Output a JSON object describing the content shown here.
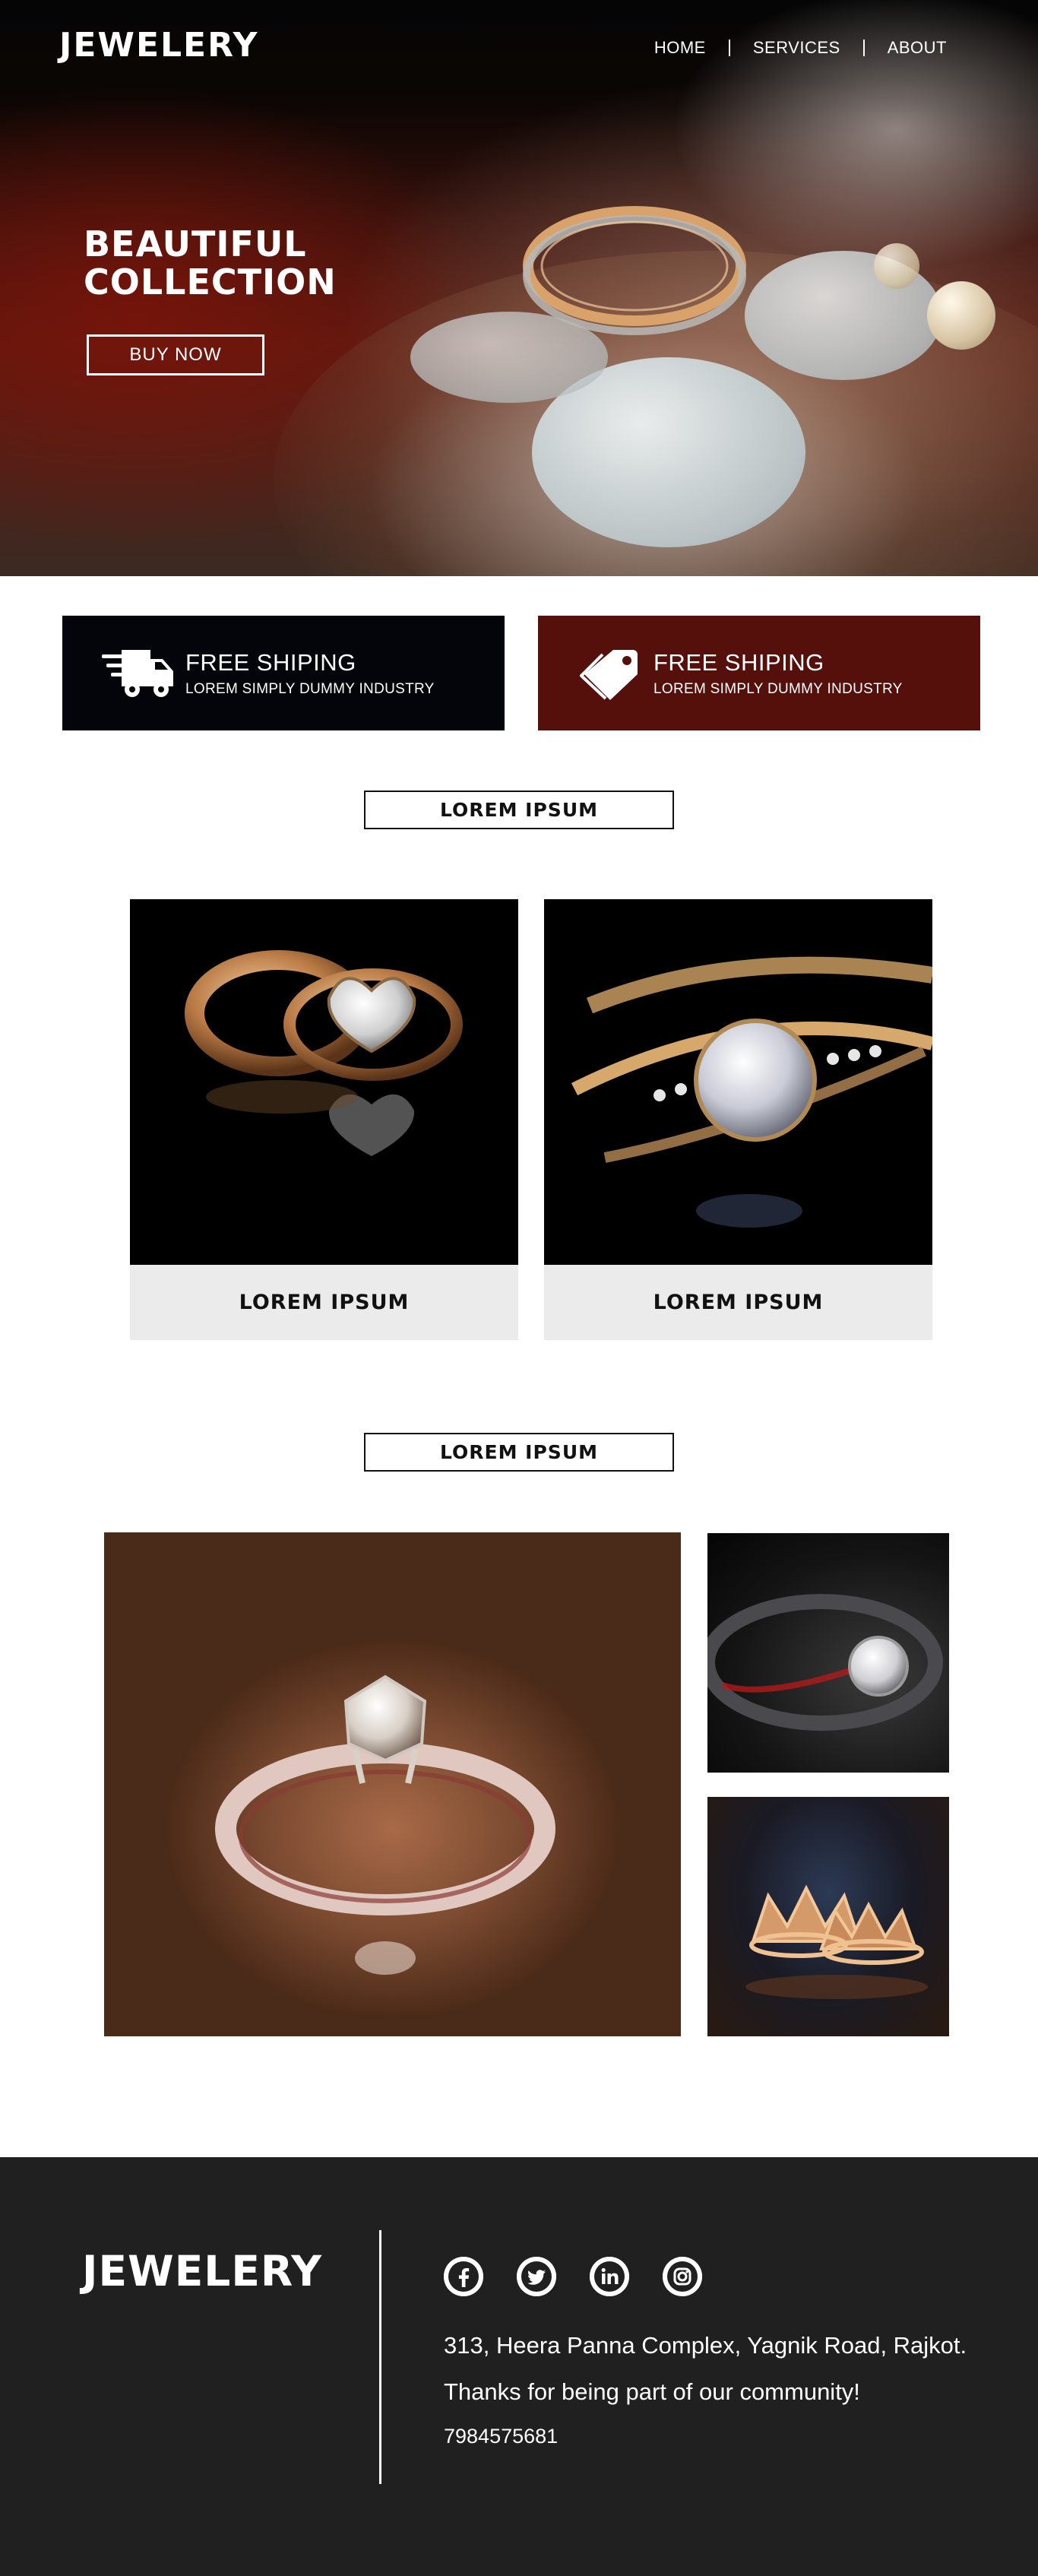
{
  "header": {
    "brand": "JEWELERY",
    "nav": [
      "HOME",
      "SERVICES",
      "ABOUT"
    ]
  },
  "hero": {
    "title_line1": "BEAUTIFUL",
    "title_line2": "COLLECTION",
    "button": "BUY NOW"
  },
  "features": [
    {
      "icon": "delivery-truck-icon",
      "title": "FREE SHIPING",
      "subtitle": "LOREM SIMPLY DUMMY INDUSTRY"
    },
    {
      "icon": "price-tag-icon",
      "title": "FREE SHIPING",
      "subtitle": "LOREM SIMPLY DUMMY INDUSTRY"
    }
  ],
  "products": {
    "heading": "LOREM IPSUM",
    "cards": [
      {
        "label": "LOREM IPSUM"
      },
      {
        "label": "LOREM IPSUM"
      }
    ]
  },
  "gallery": {
    "heading": "LOREM IPSUM"
  },
  "footer": {
    "brand": "JEWELERY",
    "socials": [
      "facebook-icon",
      "twitter-icon",
      "linkedin-icon",
      "instagram-icon"
    ],
    "address": "313, Heera Panna Complex, Yagnik Road, Rajkot.",
    "thanks": "Thanks for being part of our community!",
    "phone": "7984575681"
  },
  "colors": {
    "feature_dark": "#04050a",
    "feature_red": "#56100b",
    "footer_bg": "#202020",
    "card_label_bg": "#ebebeb"
  }
}
